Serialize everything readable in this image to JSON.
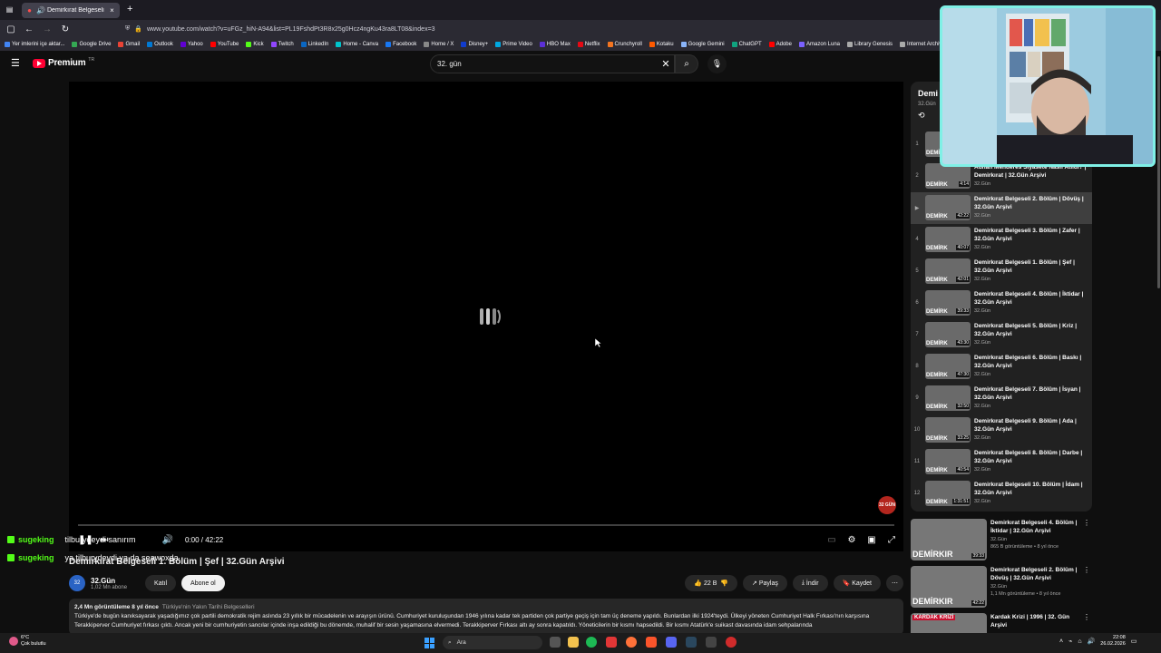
{
  "browser": {
    "tab_title": "Demirkırat Belgeseli 1. Bölü",
    "new_tab": "+",
    "url": "www.youtube.com/watch?v=uFGz_hiN-A94&list=PL19FshdPt3R8x25g0Hcz4ngKu43ra8LT08&index=3",
    "bookmarks": [
      "Yer imlerini içe aktar...",
      "Google Drive",
      "Gmail",
      "Outlook",
      "Yahoo",
      "YouTube",
      "Kick",
      "Twitch",
      "LinkedIn",
      "Home - Canva",
      "Facebook",
      "Home / X",
      "Disney+",
      "Prime Video",
      "HBO Max",
      "Netflix",
      "Crunchyroll",
      "Kotaku",
      "Google Gemini",
      "ChatGPT",
      "Adobe",
      "Amazon Luna",
      "Library Genesis",
      "Internet Archive"
    ]
  },
  "header": {
    "logo": "Premium",
    "region": "TR",
    "search_value": "32. gün"
  },
  "player": {
    "time": "0:00 / 42:22",
    "pill_text": "32 GÜN"
  },
  "chat": [
    {
      "user": "sugeking",
      "msg": "tilburydeydi sanırım"
    },
    {
      "user": "sugeking",
      "msg": "ya tilburydeydi ya da seawoxda"
    }
  ],
  "video": {
    "title": "Demirkırat Belgeseli 1. Bölüm | Şef | 32.Gün Arşivi",
    "channel": "32.Gün",
    "subs": "1,02 Mn abone",
    "join": "Katıl",
    "subscribe": "Abone ol",
    "likes": "22 B",
    "share": "Paylaş",
    "download": "İndir",
    "save": "Kaydet",
    "views": "2,4 Mn görüntüleme  8 yıl önce",
    "tag": "Türkiye'nin Yakın Tarihi Belgeselleri",
    "description": "Türkiye'de bugün kanıksayarak yaşadığımız çok partili demokratik rejim aslında 23 yıllık bir mücadelenin ve arayışın ürünü. Cumhuriyet kuruluşundan 1946 yılına kadar tek partiden çok partiye geçiş için tam üç deneme yapıldı. Bunlardan ilki 1924'teydi. Ülkeyi yöneten Cumhuriyet Halk Fırkası'nın karşısına Terakkiperver Cumhuriyet fırkası çıktı. Ancak yeni bir cumhuriyetin sancılar içinde inşa edildiği bu dönemde, muhalif bir sesin yaşamasına elvermedi. Terakkiperver Fırkası altı ay sonra kapatıldı. Yöneticilerin bir kısmı hapsedildi. Bir kısmı Atatürk'e suikast davasında idam sehpalarında"
  },
  "playlist": {
    "title": "Demi",
    "subtitle": "32.Gün",
    "items": [
      {
        "idx": "1",
        "title": "",
        "channel": "",
        "dur": ""
      },
      {
        "idx": "2",
        "title": "Adnan Menderes Siyasete Nasıl Atıldı? | Demirkırat | 32.Gün Arşivi",
        "channel": "32.Gün",
        "dur": "4:14"
      },
      {
        "idx": "▶",
        "title": "Demirkırat Belgeseli 2. Bölüm | Dövüş | 32.Gün Arşivi",
        "channel": "32.Gün",
        "dur": "42:22"
      },
      {
        "idx": "4",
        "title": "Demirkırat Belgeseli 3. Bölüm | Zafer | 32.Gün Arşivi",
        "channel": "32.Gün",
        "dur": "40:07"
      },
      {
        "idx": "5",
        "title": "Demirkırat Belgeseli 1. Bölüm | Şef | 32.Gün Arşivi",
        "channel": "32.Gün",
        "dur": "42:01"
      },
      {
        "idx": "6",
        "title": "Demirkırat Belgeseli 4. Bölüm | İktidar | 32.Gün Arşivi",
        "channel": "32.Gün",
        "dur": "39:33"
      },
      {
        "idx": "7",
        "title": "Demirkırat Belgeseli 5. Bölüm | Kriz | 32.Gün Arşivi",
        "channel": "32.Gün",
        "dur": "43:30"
      },
      {
        "idx": "8",
        "title": "Demirkırat Belgeseli 6. Bölüm | Baskı | 32.Gün Arşivi",
        "channel": "32.Gün",
        "dur": "47:30"
      },
      {
        "idx": "9",
        "title": "Demirkırat Belgeseli 7. Bölüm | İsyan | 32.Gün Arşivi",
        "channel": "32.Gün",
        "dur": "32:50"
      },
      {
        "idx": "10",
        "title": "Demirkırat Belgeseli 9. Bölüm | Ada | 32.Gün Arşivi",
        "channel": "32.Gün",
        "dur": "33:25"
      },
      {
        "idx": "11",
        "title": "Demirkırat Belgeseli 8. Bölüm | Darbe | 32.Gün Arşivi",
        "channel": "32.Gün",
        "dur": "40:54"
      },
      {
        "idx": "12",
        "title": "Demirkırat Belgeseli 10. Bölüm | İdam | 32.Gün Arşivi",
        "channel": "32.Gün",
        "dur": "1:31:51"
      }
    ]
  },
  "recommendations": [
    {
      "title": "Demirkırat Belgeseli 4. Bölüm | İktidar | 32.Gün Arşivi",
      "channel": "32.Gün",
      "meta": "865 B görüntüleme • 8 yıl önce",
      "brand": "DEMİRKIR",
      "dur": "39:33"
    },
    {
      "title": "Demirkırat Belgeseli 2. Bölüm | Dövüş | 32.Gün Arşivi",
      "channel": "32.Gün",
      "meta": "1,1 Mn görüntüleme • 8 yıl önce",
      "brand": "DEMİRKIR",
      "dur": "42:22"
    },
    {
      "title": "Kardak Krizi | 1996 | 32. Gün Arşivi",
      "channel": "",
      "meta": "",
      "brand": "KARDAK KRİZİ",
      "dur": ""
    }
  ],
  "taskbar": {
    "weather_temp": "6°C",
    "weather_desc": "Çok bulutlu",
    "search": "Ara",
    "time": "22:08",
    "date": "26.02.2026"
  },
  "colors": {
    "accent_red": "#ff0033",
    "kick_green": "#53fc18",
    "webcam_border": "#7ff0e6"
  }
}
